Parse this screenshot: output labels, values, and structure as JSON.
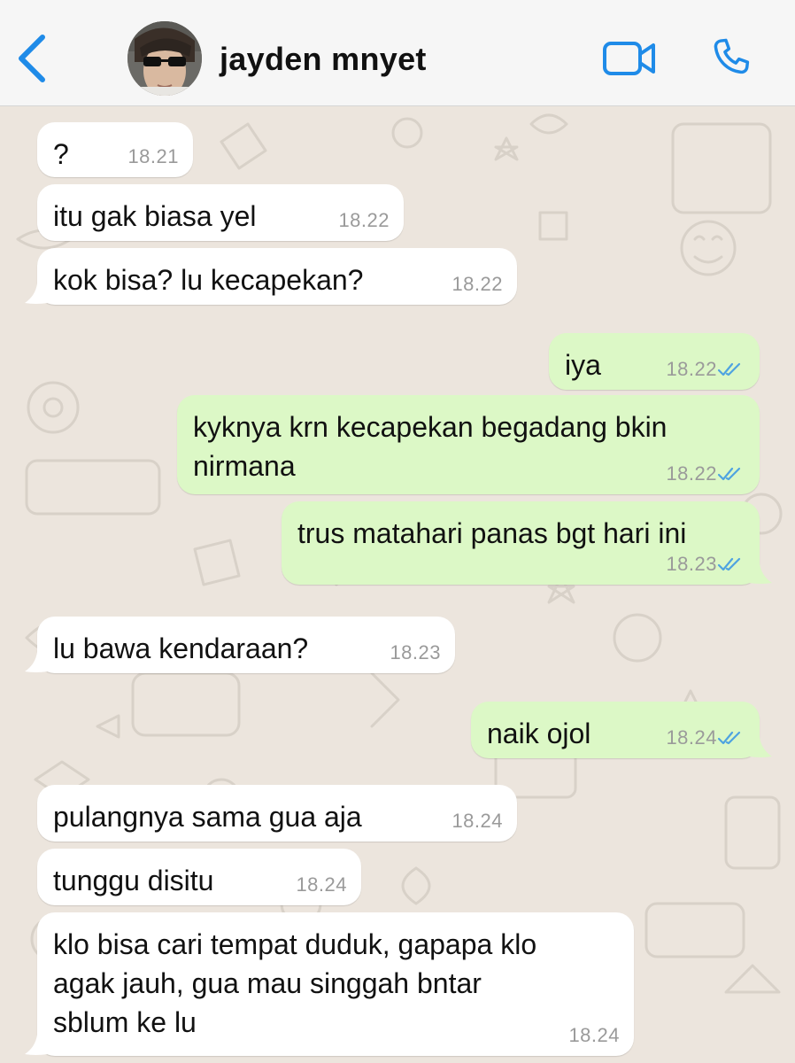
{
  "contact": {
    "name": "jayden mnyet"
  },
  "colors": {
    "accent": "#1F8BE8",
    "incoming_bubble": "#FFFFFF",
    "outgoing_bubble": "#DCF8C6",
    "read_ticks": "#4FA3E0",
    "wallpaper": "#ECE5DD"
  },
  "icons": {
    "back": "chevron-left-icon",
    "video": "video-camera-icon",
    "call": "phone-icon",
    "read_receipt": "double-check-icon"
  },
  "messages": [
    {
      "dir": "in",
      "text": "?",
      "time": "18.21"
    },
    {
      "dir": "in",
      "text": "itu gak biasa yel",
      "time": "18.22"
    },
    {
      "dir": "in",
      "text": "kok bisa? lu kecapekan?",
      "time": "18.22"
    },
    {
      "dir": "out",
      "text": "iya",
      "time": "18.22"
    },
    {
      "dir": "out",
      "text": "kyknya krn kecapekan begadang bkin\nnirmana",
      "time": "18.22"
    },
    {
      "dir": "out",
      "text": "trus matahari panas bgt hari ini",
      "time": "18.23"
    },
    {
      "dir": "in",
      "text": "lu bawa kendaraan?",
      "time": "18.23"
    },
    {
      "dir": "out",
      "text": "naik ojol",
      "time": "18.24"
    },
    {
      "dir": "in",
      "text": "pulangnya sama gua aja",
      "time": "18.24"
    },
    {
      "dir": "in",
      "text": "tunggu disitu",
      "time": "18.24"
    },
    {
      "dir": "in",
      "text": "klo bisa cari tempat duduk, gapapa klo\nagak jauh, gua mau singgah bntar\nsblum ke lu",
      "time": "18.24"
    }
  ]
}
